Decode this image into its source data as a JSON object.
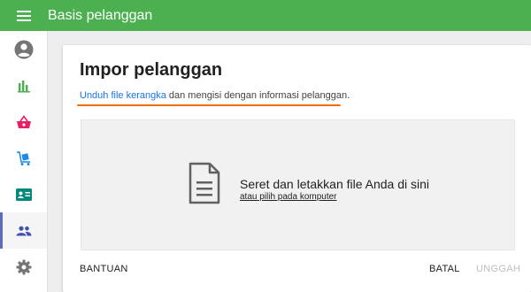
{
  "header": {
    "title": "Basis pelanggan",
    "menu_icon": "hamburger-menu-icon"
  },
  "sidebar": {
    "items": [
      {
        "name": "account-icon",
        "color": "#757575"
      },
      {
        "name": "bar-chart-icon",
        "color": "#4caf50"
      },
      {
        "name": "shopping-basket-icon",
        "color": "#e91e63"
      },
      {
        "name": "cart-box-icon",
        "color": "#1e88e5"
      },
      {
        "name": "contact-card-icon",
        "color": "#00897b"
      },
      {
        "name": "people-icon",
        "color": "#3f51b5",
        "active": true
      },
      {
        "name": "gear-icon",
        "color": "#757575"
      }
    ]
  },
  "card": {
    "title": "Impor pelanggan",
    "description_link": "Unduh file kerangka",
    "description_rest": " dan mengisi dengan informasi pelanggan.",
    "dropzone": {
      "main_text": "Seret dan letakkan file Anda di sini",
      "link_text": "atau pilih pada komputer",
      "icon": "document-icon"
    },
    "buttons": {
      "help": "BANTUAN",
      "cancel": "BATAL",
      "upload": "UNGGAH"
    }
  },
  "colors": {
    "app_bar": "#4caf50",
    "annotation_underline": "#ef6c00",
    "link": "#1a73e8",
    "disabled": "#bdbdbd"
  }
}
